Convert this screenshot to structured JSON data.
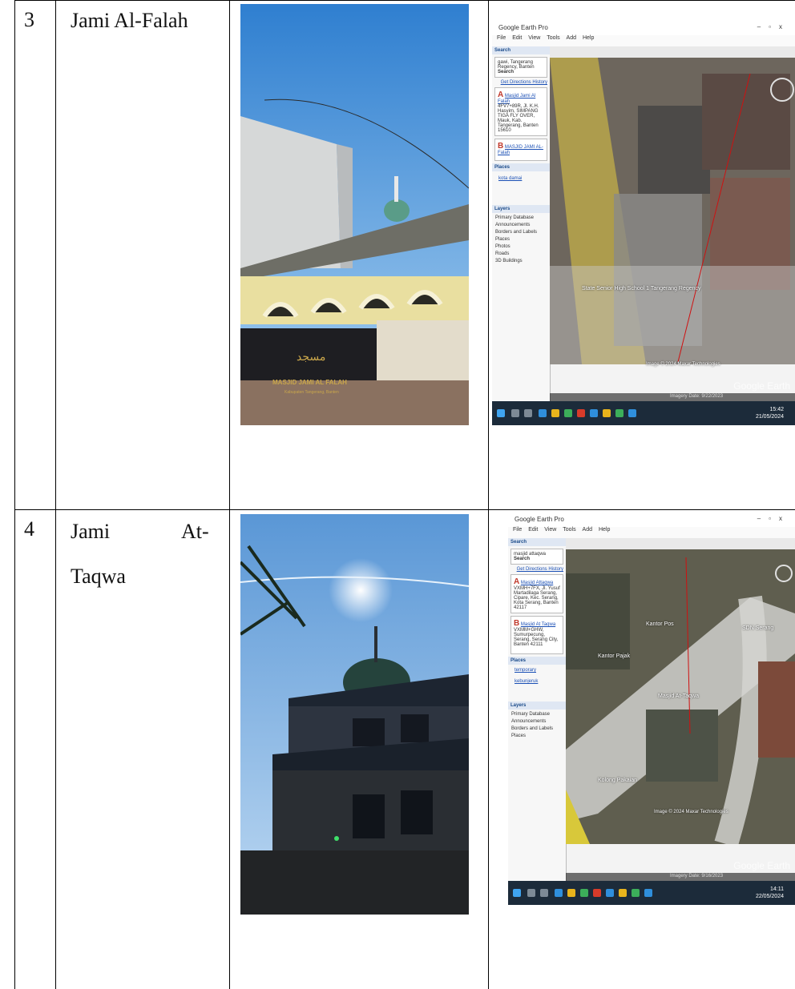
{
  "rows": [
    {
      "number": "3",
      "name": "Jami  Al-Falah",
      "photo": {
        "sign_text": "MASJID JAMI AL FALAH",
        "sign_subtext": "Kabupaten Tangerang, Banten"
      },
      "earth": {
        "window_title": "Google Earth Pro",
        "menu": [
          "File",
          "Edit",
          "View",
          "Tools",
          "Add",
          "Help"
        ],
        "search_label": "Search",
        "search_value": "gawi, Tangerang Regency, Banten",
        "search_button": "Search",
        "directions": "Get Directions  History",
        "result_a_title": "Masjid Jami Al Falah",
        "result_a_address": "4FV7+89R, Jl. K.H. Hasyim, SIMPANG TIGA FLY OVER, Mauk, Kab. Tangerang, Banten 15610",
        "result_b_title": "MASJID JAMI AL-Falah",
        "places_label": "Places",
        "place_link": "kota damai",
        "layers_label": "Layers",
        "layers": [
          "Primary Database",
          "Announcements",
          "Borders and Labels",
          "Places",
          "Photos",
          "Roads",
          "3D Buildings"
        ],
        "map_label": "State Senior High School 1 Tangerang Regency",
        "watermark": "Google Earth",
        "image_credit": "Image © 2024 Maxar Technologies",
        "status": "Imagery Date: 9/22/2023",
        "clock_time": "15:42",
        "clock_date": "21/05/2024"
      }
    },
    {
      "number": "4",
      "name_line1": "Jami",
      "name_line1b": "At-",
      "name_line2": "Taqwa",
      "earth": {
        "window_title": "Google Earth Pro",
        "menu": [
          "File",
          "Edit",
          "View",
          "Tools",
          "Add",
          "Help"
        ],
        "search_label": "Search",
        "search_value": "masjid attaqwa",
        "search_button": "Search",
        "directions": "Get Directions  History",
        "result_a_title": "Masjid Attaqwa",
        "result_a_address": "VXMH+7FX, Jl. Yusuf Martadilaga Serang, Cipare, Kec. Serang, Kota Serang, Banten 42117",
        "result_b_title": "Masjid At Taqwa",
        "result_b_address": "VXMM+GHW, Sumurpecung, Serang, Serang City, Banten 42111",
        "places_label": "Places",
        "place_link_1": "temporary",
        "place_link_2": "kebunjeruk",
        "layers_label": "Layers",
        "layers": [
          "Primary Database",
          "Announcements",
          "Borders and Labels",
          "Places"
        ],
        "map_labels": [
          "Masjid At-Taqwa",
          "Kantor Pos",
          "SDN Serang",
          "Kantor Pajak",
          "Kolong Pakaian"
        ],
        "watermark": "Google Earth",
        "image_credit": "Image © 2024 Maxar Technologies",
        "status": "Imagery Date: 9/16/2023",
        "clock_time": "14:11",
        "clock_date": "22/05/2024"
      }
    }
  ]
}
